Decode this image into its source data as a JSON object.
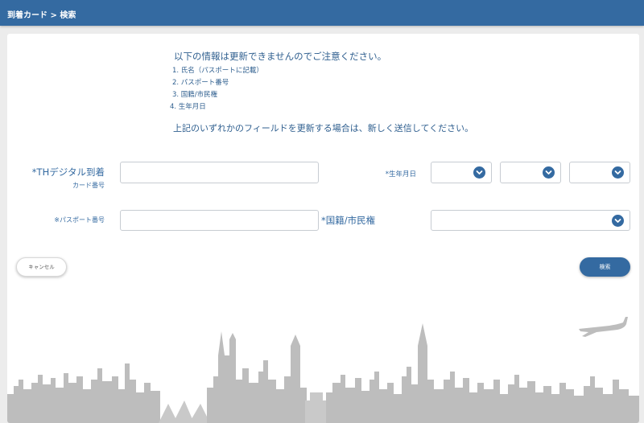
{
  "header": {
    "breadcrumb": "到着カード > 検索"
  },
  "notice": {
    "heading": "以下の情報は更新できませんのでご注意ください。",
    "items": [
      "1. 氏名（パスポートに記載）",
      "2. パスポート番号",
      "3. 国籍/市民権",
      "4. 生年月日"
    ],
    "footer": "上記のいずれかのフィールドを更新する場合は、新しく送信してください。"
  },
  "form": {
    "card_number_label": "*THデジタル到着",
    "card_number_sublabel": "カード番号",
    "card_number_value": "",
    "birth_date_label": "*生年月日",
    "passport_label": "※パスポート番号",
    "passport_value": "",
    "nationality_label": "*国籍/市民権"
  },
  "actions": {
    "cancel_label": "キャンセル",
    "search_label": "検索"
  },
  "colors": {
    "brand": "#346aa1",
    "background": "#ececec",
    "skyline": "#bdbdbd"
  }
}
